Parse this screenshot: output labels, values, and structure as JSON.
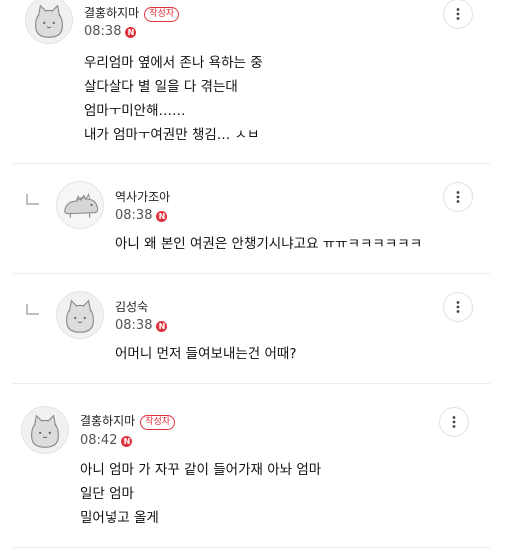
{
  "comments": [
    {
      "author": "결홍하지마",
      "author_badge": "작성자",
      "time": "08:38",
      "new_marker": "N",
      "lines": [
        "우리엄마 옆에서 존나 욕하는 중",
        "살다살다 별 일을 다 겪는대",
        "엄마ㅜ미안해……",
        "내가 엄마ㅜ여권만 챙김… ㅅㅂ"
      ],
      "is_reply": false
    },
    {
      "author": "역사가조아",
      "time": "08:38",
      "new_marker": "N",
      "lines": [
        "아니 왜 본인 여권은 안챙기시냐고요 ㅠㅠㅋㅋㅋㅋㅋㅋ"
      ],
      "is_reply": true
    },
    {
      "author": "김성숙",
      "time": "08:38",
      "new_marker": "N",
      "lines": [
        "어머니 먼저 들여보내는건 어때?"
      ],
      "is_reply": true
    },
    {
      "author": "결홍하지마",
      "author_badge": "작성자",
      "time": "08:42",
      "new_marker": "N",
      "lines": [
        "아니 엄마 가 자꾸 같이 들어가재 아놔 엄마",
        "일단 엄마",
        "밀어넣고 올게"
      ],
      "is_reply": false
    }
  ],
  "icons": {
    "more": "vertical-ellipsis-icon",
    "reply": "reply-arrow-icon",
    "avatar_default": "cat-avatar-icon",
    "avatar_custom": "dinosaur-avatar-icon"
  },
  "colors": {
    "accent_red": "#e0323c",
    "divider": "#ececec"
  }
}
